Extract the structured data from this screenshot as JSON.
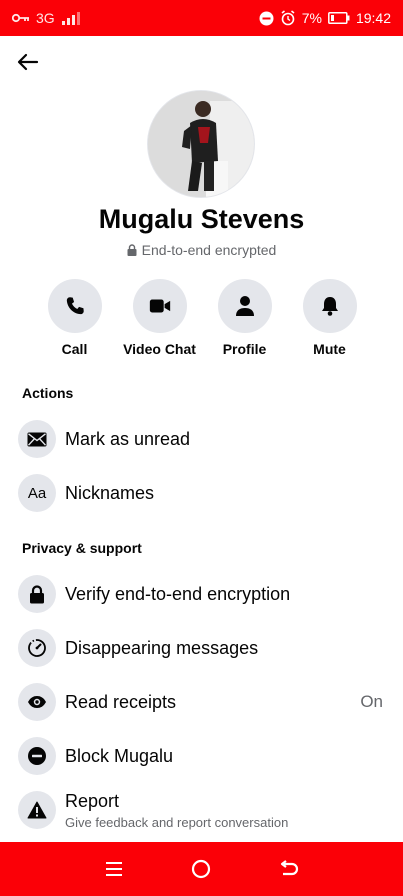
{
  "status_bar": {
    "network": "3G",
    "battery": "7%",
    "time": "19:42",
    "icons": [
      "key-icon",
      "signal-icon",
      "dnd-icon",
      "alarm-icon",
      "battery-icon"
    ]
  },
  "header": {
    "back_icon": "arrow-left-icon"
  },
  "profile": {
    "name": "Mugalu Stevens",
    "encryption_note": "End-to-end encrypted"
  },
  "quick_actions": [
    {
      "label": "Call",
      "icon": "phone-icon"
    },
    {
      "label": "Video Chat",
      "icon": "video-camera-icon"
    },
    {
      "label": "Profile",
      "icon": "person-icon"
    },
    {
      "label": "Mute",
      "icon": "bell-icon"
    }
  ],
  "sections": {
    "actions": {
      "title": "Actions",
      "items": [
        {
          "label": "Mark as unread",
          "icon": "envelope-icon"
        },
        {
          "label": "Nicknames",
          "icon": "text-aa-icon",
          "icon_text": "Aa"
        }
      ]
    },
    "privacy": {
      "title": "Privacy & support",
      "items": [
        {
          "label": "Verify end-to-end encryption",
          "icon": "lock-icon"
        },
        {
          "label": "Disappearing messages",
          "icon": "timer-icon"
        },
        {
          "label": "Read receipts",
          "icon": "eye-icon",
          "value": "On"
        },
        {
          "label": "Block Mugalu",
          "icon": "block-icon"
        },
        {
          "label": "Report",
          "sublabel": "Give feedback and report conversation",
          "icon": "warning-icon"
        }
      ]
    }
  },
  "nav_bar": {
    "buttons": [
      "menu-icon",
      "home-icon",
      "back-icon"
    ]
  },
  "colors": {
    "brand_bar": "#fb0007",
    "icon_bg": "#e4e6eb",
    "text_primary": "#050505",
    "text_secondary": "#65676b"
  }
}
